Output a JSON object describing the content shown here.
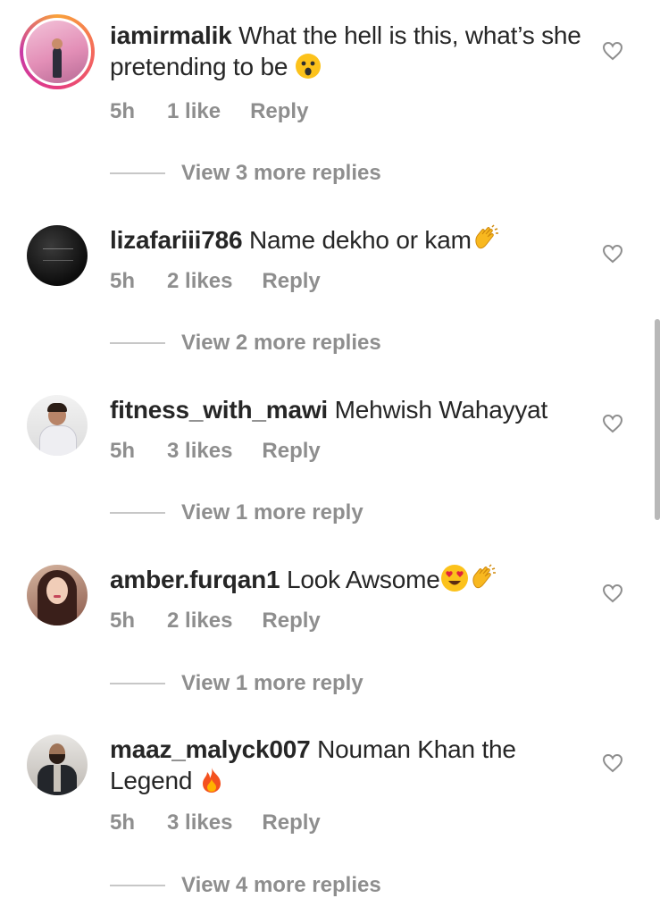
{
  "comments": [
    {
      "username": "iamirmalik",
      "text": "What the hell is this, what’s she pretending to be",
      "emoji": "astonished-face-emoji",
      "time": "5h",
      "likes": "1 like",
      "reply": "Reply",
      "view_replies": "View 3 more replies",
      "avatar_style": "story-ring"
    },
    {
      "username": "lizafariii786",
      "text": "Name dekho or kam",
      "emoji": "clapping-hands-emoji",
      "time": "5h",
      "likes": "2 likes",
      "reply": "Reply",
      "view_replies": "View 2 more replies"
    },
    {
      "username": "fitness_with_mawi",
      "text": "Mehwish Wahayyat",
      "time": "5h",
      "likes": "3 likes",
      "reply": "Reply",
      "view_replies": "View 1 more reply"
    },
    {
      "username": "amber.furqan1",
      "text": "Look Awsome",
      "emoji": "heart-eyes-and-clapping-hands-emoji",
      "time": "5h",
      "likes": "2 likes",
      "reply": "Reply",
      "view_replies": "View 1 more reply"
    },
    {
      "username": "maaz_malyck007",
      "text": "Nouman Khan the Legend",
      "emoji": "fire-emoji",
      "time": "5h",
      "likes": "3 likes",
      "reply": "Reply",
      "view_replies": "View 4 more replies"
    }
  ],
  "icons": {
    "like": "heart-outline-icon"
  },
  "colors": {
    "text": "#262626",
    "meta": "#8e8e8e",
    "divider": "#c7c7c7",
    "story_ring": [
      "#f9a23a",
      "#e63d7e",
      "#c93aa6"
    ]
  }
}
